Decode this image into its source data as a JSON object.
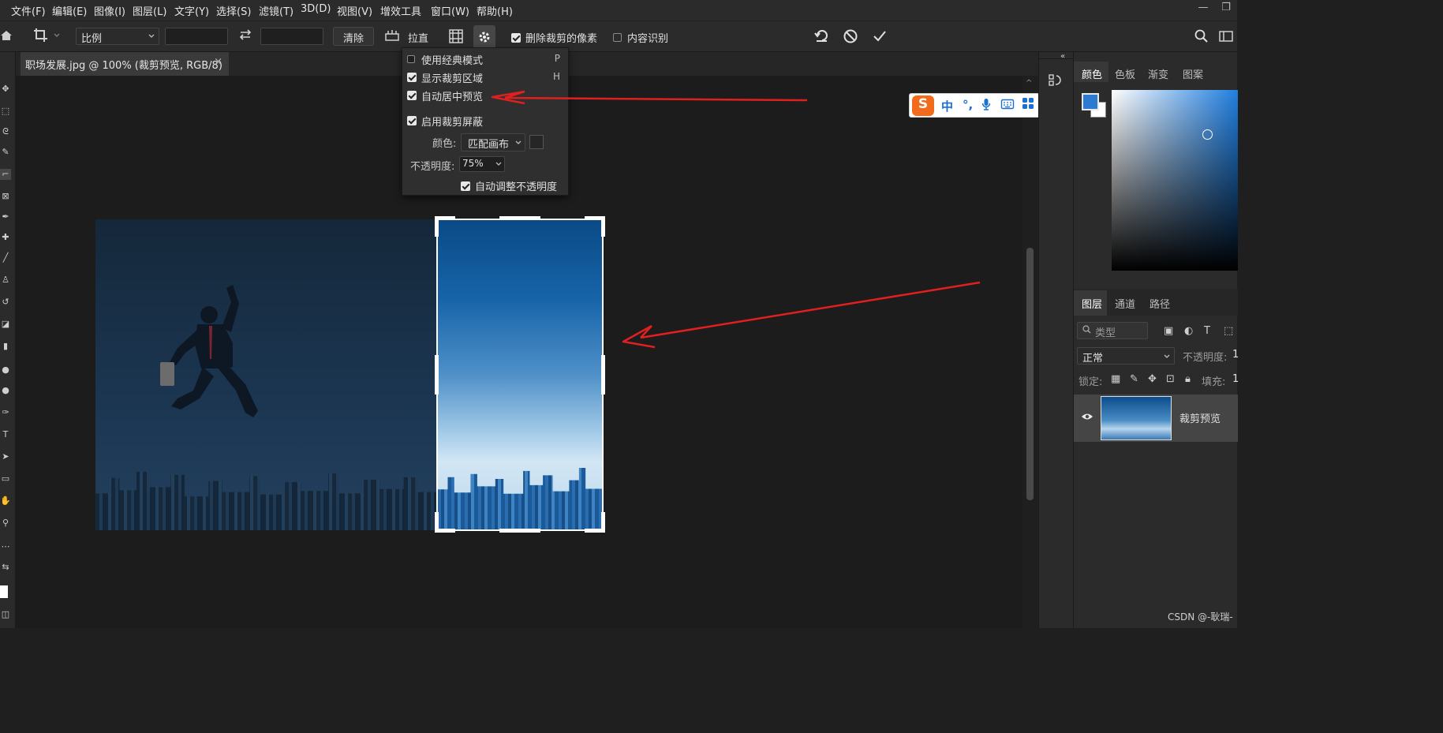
{
  "menu": {
    "items": [
      "文件(F)",
      "编辑(E)",
      "图像(I)",
      "图层(L)",
      "文字(Y)",
      "选择(S)",
      "滤镜(T)",
      "3D(D)",
      "视图(V)",
      "增效工具",
      "窗口(W)",
      "帮助(H)"
    ],
    "minimize_icon": "—",
    "restore_icon": "❐"
  },
  "options": {
    "ratio_select": "比例",
    "clear_label": "清除",
    "straighten_label": "拉直",
    "delete_cropped_label": "删除裁剪的像素",
    "content_aware_label": "内容识别",
    "delete_cropped_checked": true,
    "content_aware_checked": false
  },
  "document": {
    "tab_title": "职场发展.jpg @ 100% (裁剪预览, RGB/8)",
    "close_glyph": "×"
  },
  "gear_panel": {
    "classic_mode": {
      "label": "使用经典模式",
      "key": "P",
      "checked": false
    },
    "show_crop_area": {
      "label": "显示裁剪区域",
      "key": "H",
      "checked": true
    },
    "auto_center": {
      "label": "自动居中预览",
      "checked": true
    },
    "enable_shield": {
      "label": "启用裁剪屏蔽",
      "checked": true
    },
    "color_label": "颜色:",
    "color_value": "匹配画布",
    "opacity_label": "不透明度:",
    "opacity_value": "75%",
    "auto_opacity": {
      "label": "自动调整不透明度",
      "checked": true
    }
  },
  "ime": {
    "logo": "S",
    "items": [
      "中",
      "°,",
      "🎤",
      "⌨",
      "▦"
    ]
  },
  "color_panel": {
    "tabs": [
      "颜色",
      "色板",
      "渐变",
      "图案"
    ],
    "foreground": "#2c7bd0",
    "background": "#ffffff"
  },
  "layers_panel": {
    "tabs": [
      "图层",
      "通道",
      "路径"
    ],
    "filter_placeholder": "类型",
    "blend_mode": "正常",
    "opacity_label": "不透明度:",
    "opacity_value": "1",
    "lock_label": "锁定:",
    "fill_label": "填充:",
    "fill_value": "1",
    "layer_name": "裁剪预览"
  },
  "watermark": "CSDN @-耿瑞-",
  "colors": {
    "annotation_arrow": "#e0201f",
    "ime_orange": "#f26a1b",
    "ime_blue": "#1a6fd0"
  }
}
